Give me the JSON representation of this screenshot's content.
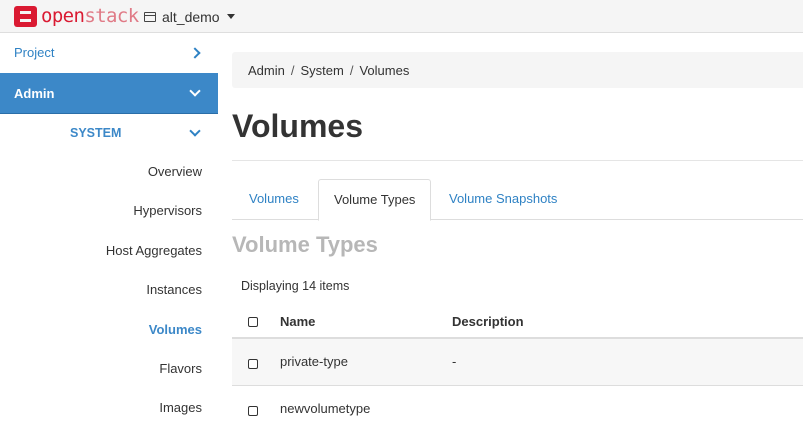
{
  "topbar": {
    "brand_bold": "open",
    "brand_light": "stack",
    "project": "alt_demo"
  },
  "sidebar": {
    "project_label": "Project",
    "admin_label": "Admin",
    "system_label": "SYSTEM",
    "items": [
      {
        "label": "Overview"
      },
      {
        "label": "Hypervisors"
      },
      {
        "label": "Host Aggregates"
      },
      {
        "label": "Instances"
      },
      {
        "label": "Volumes",
        "active": true
      },
      {
        "label": "Flavors"
      },
      {
        "label": "Images"
      }
    ]
  },
  "breadcrumb": [
    "Admin",
    "System",
    "Volumes"
  ],
  "page_title": "Volumes",
  "tabs": [
    {
      "label": "Volumes"
    },
    {
      "label": "Volume Types",
      "active": true
    },
    {
      "label": "Volume Snapshots"
    }
  ],
  "section_title": "Volume Types",
  "count_text": "Displaying 14 items",
  "table": {
    "columns": [
      "Name",
      "Description"
    ],
    "rows": [
      {
        "name": "private-type",
        "description": "-"
      },
      {
        "name": "newvolumetype",
        "description": ""
      }
    ]
  },
  "colors": {
    "brand": "#da1a32",
    "accent": "#3c88c8",
    "link": "#2f82c4"
  }
}
